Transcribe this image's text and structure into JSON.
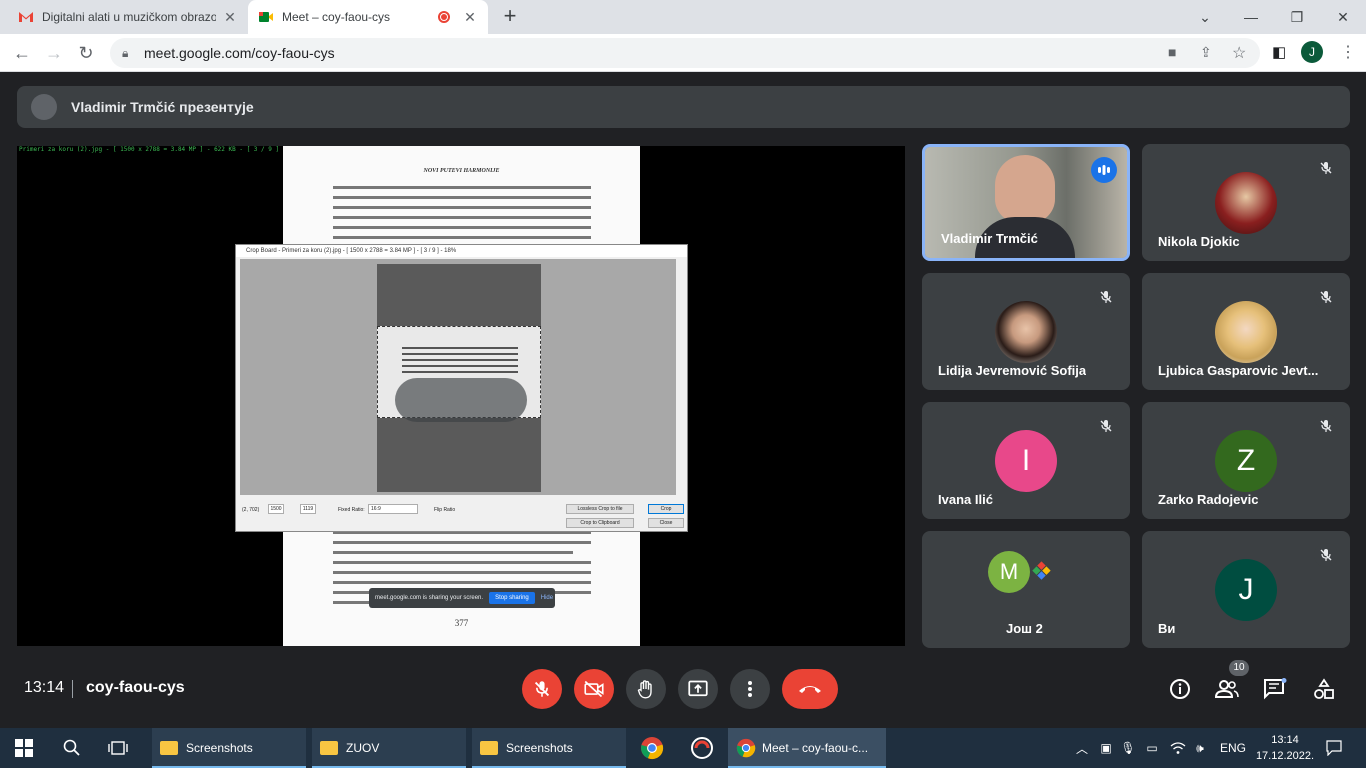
{
  "browser": {
    "tabs": [
      {
        "title": "Digitalni alati u muzičkom obrazo",
        "active": false
      },
      {
        "title": "Meet – coy-faou-cys",
        "active": true
      }
    ],
    "url": "meet.google.com/coy-faou-cys",
    "profile_initial": "J"
  },
  "meet": {
    "presenter_label": "Vladimir Trmčić презентује",
    "stage": {
      "overlay_text": "Primeri za koru (2).jpg - [ 1500 x 2788 = 3.84 MP ] - 622 KB - [ 3 / 9 ] - 32%",
      "doc_header": "NOVI PUTEVI HARMONIJE",
      "doc_page": "377",
      "crop_title": "Crop Board - Primeri za koru (2).jpg - [ 1500 x 2788 = 3.84 MP ] - [ 3 / 9 ] - 18%",
      "crop_coords": "(2, 702)",
      "crop_w": "1500",
      "crop_h": "1119",
      "fixed_ratio_label": "Fixed Ratio:",
      "fixed_ratio_value": "16:9",
      "flip_label": "Flip Ratio",
      "lossless_label": "Lossless Crop to file",
      "btn_crop": "Crop",
      "btn_clipboard": "Crop to Clipboard",
      "btn_close": "Close",
      "share_notice": "meet.google.com is sharing your screen.",
      "stop_sharing": "Stop sharing",
      "hide": "Hide"
    },
    "participants": [
      {
        "name": "Vladimir Trmčić",
        "type": "video",
        "speaking": true
      },
      {
        "name": "Nikola Djokic",
        "type": "photo",
        "muted": true
      },
      {
        "name": "Lidija Jevremović Sofija",
        "type": "photo",
        "muted": true
      },
      {
        "name": "Ljubica Gasparovic Jevt...",
        "type": "photo",
        "muted": true
      },
      {
        "name": "Ivana Ilić",
        "initial": "I",
        "color": "#e8488a",
        "muted": true
      },
      {
        "name": "Zarko Radojevic",
        "initial": "Z",
        "color": "#33691e",
        "muted": true
      },
      {
        "name": "Још 2",
        "initial": "M",
        "color": "#7cb342"
      },
      {
        "name": "Ви",
        "initial": "J",
        "color": "#004d40",
        "muted": true
      }
    ],
    "controls": {
      "time": "13:14",
      "meeting_code": "coy-faou-cys",
      "people_count": "10"
    }
  },
  "taskbar": {
    "items": [
      "Screenshots",
      "ZUOV",
      "Screenshots",
      "Meet – coy-faou-c..."
    ],
    "language": "ENG",
    "time": "13:14",
    "date": "17.12.2022."
  },
  "colors": {
    "meet_bg": "#202124",
    "tile_bg": "#3c4043",
    "accent_blue": "#1a73e8",
    "danger_red": "#ea4335"
  }
}
